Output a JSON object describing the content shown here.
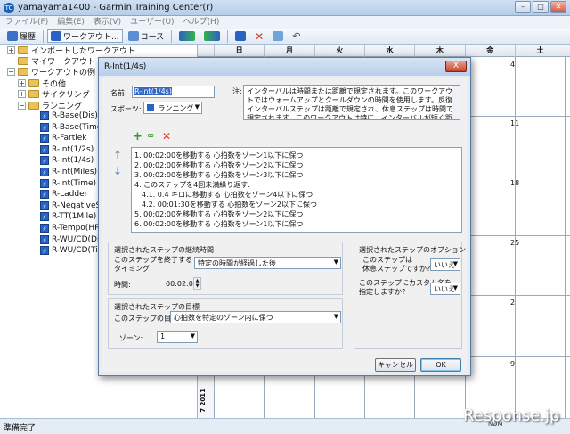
{
  "app": {
    "title": "yamayama1400 - Garmin Training Center(r)",
    "icon_label": "TC"
  },
  "menu": [
    "ファイル(F)",
    "編集(E)",
    "表示(V)",
    "ユーザー(U)",
    "ヘルプ(H)"
  ],
  "toolbar": {
    "history_label": "履歴",
    "workouts_label": "ワークアウト...",
    "courses_label": "コース"
  },
  "tree": {
    "imported": "インポートしたワークアウト",
    "my_workouts": "マイワークアウト",
    "examples": "ワークアウトの例",
    "other": "その他",
    "cycling": "サイクリング",
    "running": "ランニング",
    "workouts": [
      "R-Base(Dis)",
      "R-Base(Time)",
      "R-Fartlek",
      "R-Int(1/2s)",
      "R-Int(1/4s)",
      "R-Int(Miles)",
      "R-Int(Time)",
      "R-Ladder",
      "R-NegativeSpl",
      "R-TT(1Mile)",
      "R-Tempo(HR)",
      "R-WU/CD(Dis",
      "R-WU/CD(Tim"
    ]
  },
  "calendar": {
    "weekdays": [
      "日",
      "月",
      "火",
      "水",
      "木",
      "金",
      "土"
    ],
    "day_numbers": [
      "4",
      "11",
      "18",
      "25",
      "2",
      "9"
    ],
    "week_label": "7 2011"
  },
  "status": {
    "text": "準備完了",
    "num": "NUM"
  },
  "watermark": "Response.jp",
  "dialog": {
    "title": "R-Int(1/4s)",
    "close_label": "X",
    "name_label": "名前:",
    "name_value": "R-Int(1/4s)",
    "sport_label": "スポーツ:",
    "sport_value": "ランニング",
    "note_label": "注:",
    "note_text": "インターバルは時間または距離で規定されます。このワークアウトではウォームアップとクールダウンの時間を使用します。反復インターバルステップは距離で規定され、休息ステップは時間で規定されます。このワークアウトは特に、インターバルが短く距離が高いため、休息時間をインターバルが完了するまでにか",
    "steps": [
      "1. 00:02:00を移動する 心拍数をゾーン1以下に保つ",
      "2. 00:02:00を移動する 心拍数をゾーン2以下に保つ",
      "3. 00:02:00を移動する 心拍数をゾーン3以下に保つ",
      "4. このステップを4回未満繰り返す:",
      "4.1. 0.4 キロに移動する 心拍数をゾーン4以下に保つ",
      "4.2. 00:01:30を移動する 心拍数をゾーン2以下に保つ",
      "5. 00:02:00を移動する 心拍数をゾーン2以下に保つ",
      "6. 00:02:00を移動する 心拍数をゾーン1以下に保つ"
    ],
    "duration": {
      "section_title": "選択されたステップの継続時間",
      "end_label": "このステップを終了する\nタイミング:",
      "end_value": "特定の時間が経過した後",
      "time_label": "時間:",
      "time_value": "00:02:00"
    },
    "target": {
      "section_title": "選択されたステップの目標",
      "target_label": "このステップの目標:",
      "target_value": "心拍数を特定のゾーン内に保つ",
      "zone_label": "ゾーン:",
      "zone_value": "1"
    },
    "options": {
      "section_title": "選択されたステップのオプション",
      "rest_label": "このステップは\n休息ステップですか?",
      "rest_value": "いいえ",
      "custom_label": "このステップにカスタム名を\n指定しますか?",
      "custom_value": "いいえ"
    },
    "cancel_label": "キャンセル",
    "ok_label": "OK"
  }
}
